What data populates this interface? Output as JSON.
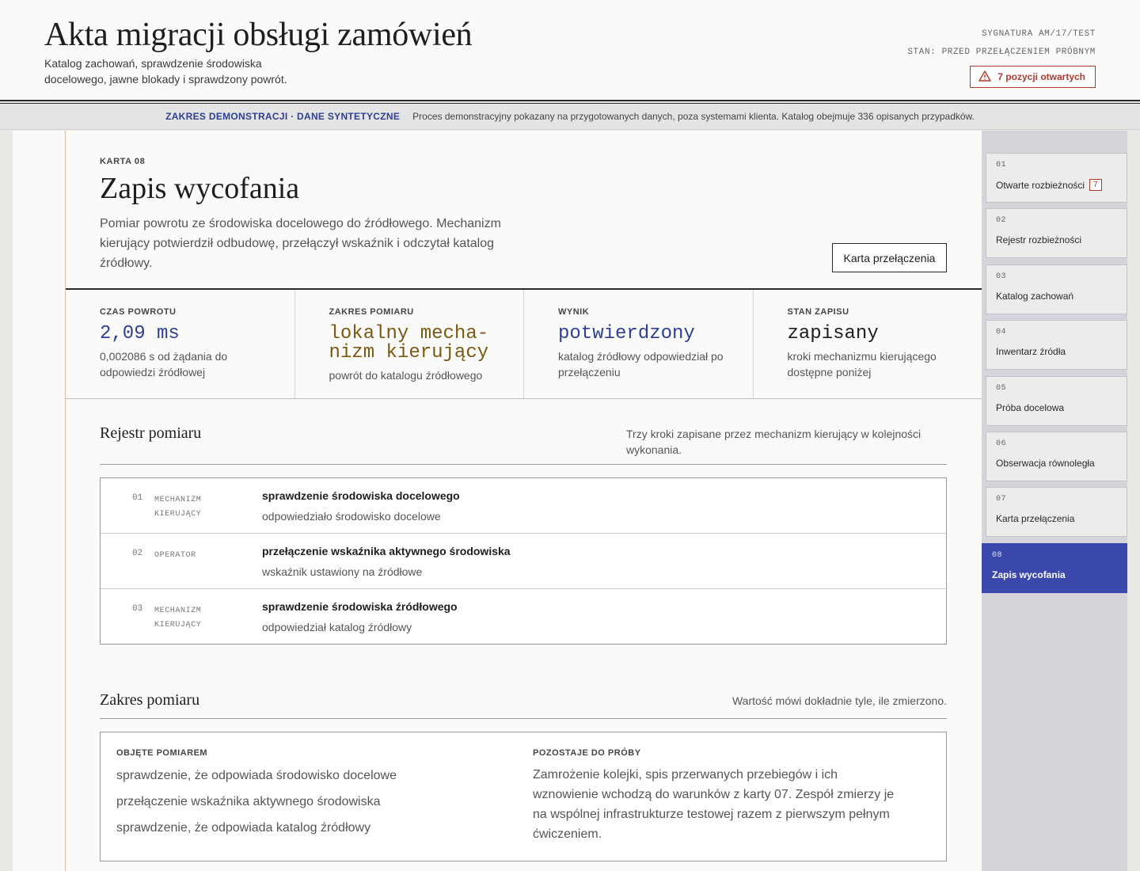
{
  "header": {
    "title": "Akta migracji obsługi zamówień",
    "subtitle": "Katalog zachowań, sprawdzenie środowiska docelowego, jawne blokady i sprawdzony powrót.",
    "signature": "SYGNATURA AM/17/TEST",
    "state": "STAN: PRZED PRZEŁĄCZENIEM PRÓBNYM",
    "open_items": "7 pozycji otwartych",
    "warning_icon": "warning-triangle-icon",
    "accent_color": "#b03a2e"
  },
  "banner": {
    "label": "ZAKRES DEMONSTRACJI · DANE SYNTETYCZNE",
    "text": "Proces demonstracyjny pokazany na przygotowanych danych, poza systemami klienta. Katalog obejmuje 336 opisanych przypadków."
  },
  "card": {
    "label": "KARTA 08",
    "title": "Zapis wycofania",
    "description": "Pomiar powrotu ze środowiska docelowego do źródłowego. Mechanizm kierujący potwierdził odbudowę, przełączył wskaźnik i odczytał katalog źródłowy.",
    "button": "Karta przełączenia"
  },
  "metrics": [
    {
      "label": "CZAS POWROTU",
      "value": "2,09 ms",
      "note": "0,002086 s od żądania do odpowiedzi źródłowej",
      "color": "#2e3f94"
    },
    {
      "label": "ZAKRES POMIARU",
      "value": "lokalny mecha-nizm kierujący",
      "note": "powrót do katalogu źródłowego",
      "color": "#7a5a13"
    },
    {
      "label": "WYNIK",
      "value": "potwierdzony",
      "note": "katalog źródłowy odpowiedział po przełączeniu",
      "color": "#2e3f94"
    },
    {
      "label": "STAN ZAPISU",
      "value": "zapisany",
      "note": "kroki mechanizmu kierującego dostępne poniżej",
      "color": "#1e1e1e"
    }
  ],
  "register": {
    "title": "Rejestr pomiaru",
    "note": "Trzy kroki zapisane przez mechanizm kierujący w kolejności wykonania.",
    "steps": [
      {
        "num": "01",
        "actor": "MECHANIZM KIERUJĄCY",
        "title": "sprawdzenie środowiska docelowego",
        "result": "odpowiedziało środowisko docelowe"
      },
      {
        "num": "02",
        "actor": "OPERATOR",
        "title": "przełączenie wskaźnika aktywnego środowiska",
        "result": "wskaźnik ustawiony na źródłowe"
      },
      {
        "num": "03",
        "actor": "MECHANIZM KIERUJĄCY",
        "title": "sprawdzenie środowiska źródłowego",
        "result": "odpowiedział katalog źródłowy"
      }
    ]
  },
  "scope": {
    "title": "Zakres pomiaru",
    "note": "Wartość mówi dokładnie tyle, ile zmierzono.",
    "covered_label": "OBJĘTE POMIAREM",
    "covered": [
      "sprawdzenie, że odpowiada środowisko docelowe",
      "przełączenie wskaźnika aktywnego środowiska",
      "sprawdzenie, że odpowiada katalog źródłowy"
    ],
    "pending_label": "POZOSTAJE DO PRÓBY",
    "pending_text": "Zamrożenie kolejki, spis przerwanych przebiegów i ich wznowienie wchodzą do warunków z karty 07. Zespół zmierzy je na wspólnej infrastrukturze testowej razem z pierwszym pełnym ćwiczeniem."
  },
  "sidebar": {
    "items": [
      {
        "num": "01",
        "label": "Otwarte rozbieżności",
        "badge": "7"
      },
      {
        "num": "02",
        "label": "Rejestr rozbieżności"
      },
      {
        "num": "03",
        "label": "Katalog zachowań"
      },
      {
        "num": "04",
        "label": "Inwentarz źródła"
      },
      {
        "num": "05",
        "label": "Próba docelowa"
      },
      {
        "num": "06",
        "label": "Obserwacja równoległa"
      },
      {
        "num": "07",
        "label": "Karta przełączenia"
      },
      {
        "num": "08",
        "label": "Zapis wycofania",
        "active": true
      }
    ],
    "active_color": "#3a48ab"
  }
}
